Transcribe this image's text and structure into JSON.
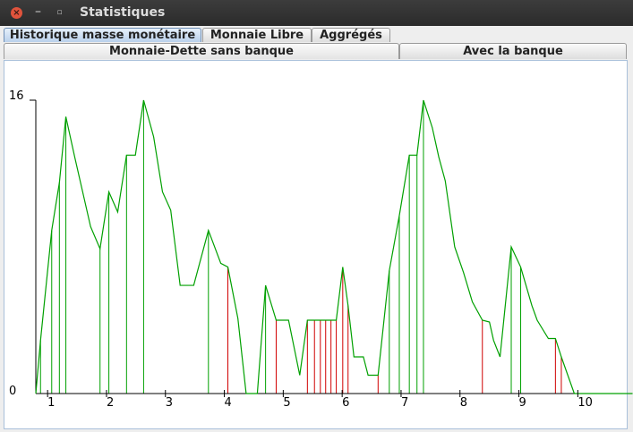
{
  "window": {
    "title": "Statistiques"
  },
  "tabs": [
    {
      "label": "Historique masse monétaire",
      "active": true
    },
    {
      "label": "Monnaie Libre",
      "active": false
    },
    {
      "label": "Aggrégés",
      "active": false
    }
  ],
  "subtabs": [
    {
      "label": "Monnaie-Dette sans banque",
      "active": true
    },
    {
      "label": "Avec la banque",
      "active": false
    }
  ],
  "colors": {
    "line": "#00a000",
    "stem_green": "#00a000",
    "stem_red": "#d00000",
    "axis": "#000000"
  },
  "chart_data": {
    "type": "line",
    "title": "",
    "xlabel": "",
    "ylabel": "",
    "ylim": [
      0,
      16
    ],
    "xlim": [
      0.8,
      11.5
    ],
    "y_ticks": [
      "0",
      "16"
    ],
    "x_ticks": [
      "1",
      "2",
      "3",
      "4",
      "5",
      "6",
      "7",
      "8",
      "9",
      "10"
    ],
    "x": [
      0.8,
      0.88,
      1.07,
      1.2,
      1.31,
      1.46,
      1.73,
      1.89,
      2.04,
      2.19,
      2.34,
      2.49,
      2.63,
      2.8,
      2.95,
      3.09,
      3.25,
      3.48,
      3.73,
      3.94,
      4.06,
      4.23,
      4.37,
      4.56,
      4.7,
      4.88,
      5.09,
      5.28,
      5.41,
      5.53,
      5.72,
      5.9,
      6.01,
      6.1,
      6.2,
      6.36,
      6.44,
      6.61,
      6.8,
      6.97,
      7.14,
      7.27,
      7.38,
      7.53,
      7.64,
      7.75,
      7.91,
      8.06,
      8.21,
      8.38,
      8.5,
      8.57,
      8.68,
      8.87,
      9.03,
      9.22,
      9.31,
      9.5,
      9.62,
      9.72,
      9.94,
      10.08,
      10.14,
      10.35,
      10.48,
      10.69,
      10.8,
      10.93
    ],
    "y": [
      0,
      2.9,
      8.9,
      11.5,
      15.1,
      12.9,
      9.1,
      7.9,
      11.0,
      9.9,
      13.0,
      13.0,
      16.0,
      14.0,
      11.0,
      10.0,
      5.9,
      5.9,
      8.9,
      7.1,
      6.9,
      4.1,
      0,
      0,
      5.9,
      4.0,
      4.0,
      1.0,
      4.0,
      4.0,
      4.0,
      4.0,
      6.9,
      4.8,
      2.0,
      2.0,
      1.0,
      1.0,
      6.7,
      9.7,
      13.0,
      13.0,
      16.0,
      14.5,
      12.9,
      11.6,
      8.0,
      6.6,
      5.0,
      4.0,
      3.9,
      2.9,
      2.0,
      8.0,
      6.9,
      4.8,
      4.0,
      3.0,
      3.0,
      2.0,
      0,
      0,
      0,
      0,
      0,
      0,
      0,
      0
    ],
    "stems": [
      {
        "x": 0.88,
        "y": 2.9,
        "color": "green"
      },
      {
        "x": 1.07,
        "y": 8.9,
        "color": "green"
      },
      {
        "x": 1.2,
        "y": 11.5,
        "color": "green"
      },
      {
        "x": 1.31,
        "y": 15.1,
        "color": "green"
      },
      {
        "x": 1.89,
        "y": 7.9,
        "color": "green"
      },
      {
        "x": 2.04,
        "y": 11.0,
        "color": "green"
      },
      {
        "x": 2.34,
        "y": 13.0,
        "color": "green"
      },
      {
        "x": 2.63,
        "y": 16.0,
        "color": "green"
      },
      {
        "x": 3.73,
        "y": 8.9,
        "color": "green"
      },
      {
        "x": 4.06,
        "y": 6.9,
        "color": "red"
      },
      {
        "x": 4.7,
        "y": 5.9,
        "color": "green"
      },
      {
        "x": 4.88,
        "y": 4.0,
        "color": "red"
      },
      {
        "x": 5.41,
        "y": 4.0,
        "color": "red"
      },
      {
        "x": 5.53,
        "y": 4.0,
        "color": "red"
      },
      {
        "x": 5.63,
        "y": 4.0,
        "color": "red"
      },
      {
        "x": 5.72,
        "y": 4.0,
        "color": "red"
      },
      {
        "x": 5.81,
        "y": 4.0,
        "color": "red"
      },
      {
        "x": 5.9,
        "y": 4.0,
        "color": "red"
      },
      {
        "x": 6.01,
        "y": 6.9,
        "color": "red"
      },
      {
        "x": 6.1,
        "y": 4.8,
        "color": "red"
      },
      {
        "x": 6.61,
        "y": 1.0,
        "color": "red"
      },
      {
        "x": 6.8,
        "y": 6.7,
        "color": "green"
      },
      {
        "x": 6.97,
        "y": 9.7,
        "color": "green"
      },
      {
        "x": 7.14,
        "y": 13.0,
        "color": "green"
      },
      {
        "x": 7.27,
        "y": 13.0,
        "color": "green"
      },
      {
        "x": 7.38,
        "y": 16.0,
        "color": "green"
      },
      {
        "x": 8.38,
        "y": 4.0,
        "color": "red"
      },
      {
        "x": 8.87,
        "y": 8.0,
        "color": "green"
      },
      {
        "x": 9.03,
        "y": 6.9,
        "color": "green"
      },
      {
        "x": 9.62,
        "y": 3.0,
        "color": "red"
      },
      {
        "x": 9.72,
        "y": 2.0,
        "color": "red"
      }
    ]
  }
}
